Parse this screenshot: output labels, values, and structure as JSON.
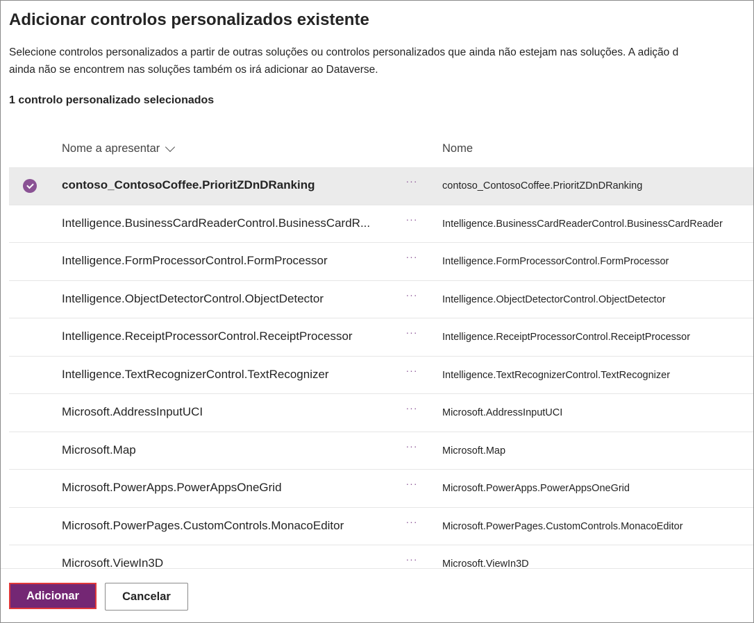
{
  "dialog": {
    "title": "Adicionar controlos personalizados existente",
    "description_line1": "Selecione controlos personalizados a partir de outras soluções ou controlos personalizados que ainda não estejam nas soluções. A adição d",
    "description_line2": "ainda não se encontrem nas soluções também os irá adicionar ao Dataverse.",
    "selected_count": "1 controlo personalizado selecionados"
  },
  "table": {
    "columns": {
      "display_name": "Nome a apresentar",
      "name": "Nome"
    },
    "rows": [
      {
        "display": "contoso_ContosoCoffee.PrioritZDnDRanking",
        "name": "contoso_ContosoCoffee.PrioritZDnDRanking",
        "selected": true
      },
      {
        "display": "Intelligence.BusinessCardReaderControl.BusinessCardR...",
        "name": "Intelligence.BusinessCardReaderControl.BusinessCardReader",
        "selected": false
      },
      {
        "display": "Intelligence.FormProcessorControl.FormProcessor",
        "name": "Intelligence.FormProcessorControl.FormProcessor",
        "selected": false
      },
      {
        "display": "Intelligence.ObjectDetectorControl.ObjectDetector",
        "name": "Intelligence.ObjectDetectorControl.ObjectDetector",
        "selected": false
      },
      {
        "display": "Intelligence.ReceiptProcessorControl.ReceiptProcessor",
        "name": "Intelligence.ReceiptProcessorControl.ReceiptProcessor",
        "selected": false
      },
      {
        "display": "Intelligence.TextRecognizerControl.TextRecognizer",
        "name": "Intelligence.TextRecognizerControl.TextRecognizer",
        "selected": false
      },
      {
        "display": "Microsoft.AddressInputUCI",
        "name": "Microsoft.AddressInputUCI",
        "selected": false
      },
      {
        "display": "Microsoft.Map",
        "name": "Microsoft.Map",
        "selected": false
      },
      {
        "display": "Microsoft.PowerApps.PowerAppsOneGrid",
        "name": "Microsoft.PowerApps.PowerAppsOneGrid",
        "selected": false
      },
      {
        "display": "Microsoft.PowerPages.CustomControls.MonacoEditor",
        "name": "Microsoft.PowerPages.CustomControls.MonacoEditor",
        "selected": false
      },
      {
        "display": "Microsoft.ViewIn3D",
        "name": "Microsoft.ViewIn3D",
        "selected": false
      }
    ],
    "more_icon": "more-horizontal-icon",
    "sort_icon": "chevron-down-icon",
    "check_icon": "checkmark-circle-icon"
  },
  "footer": {
    "add_label": "Adicionar",
    "cancel_label": "Cancelar"
  },
  "colors": {
    "accent": "#742774",
    "check": "#8a5294",
    "focus_border": "#e0383a",
    "selected_row": "#ebebeb"
  }
}
